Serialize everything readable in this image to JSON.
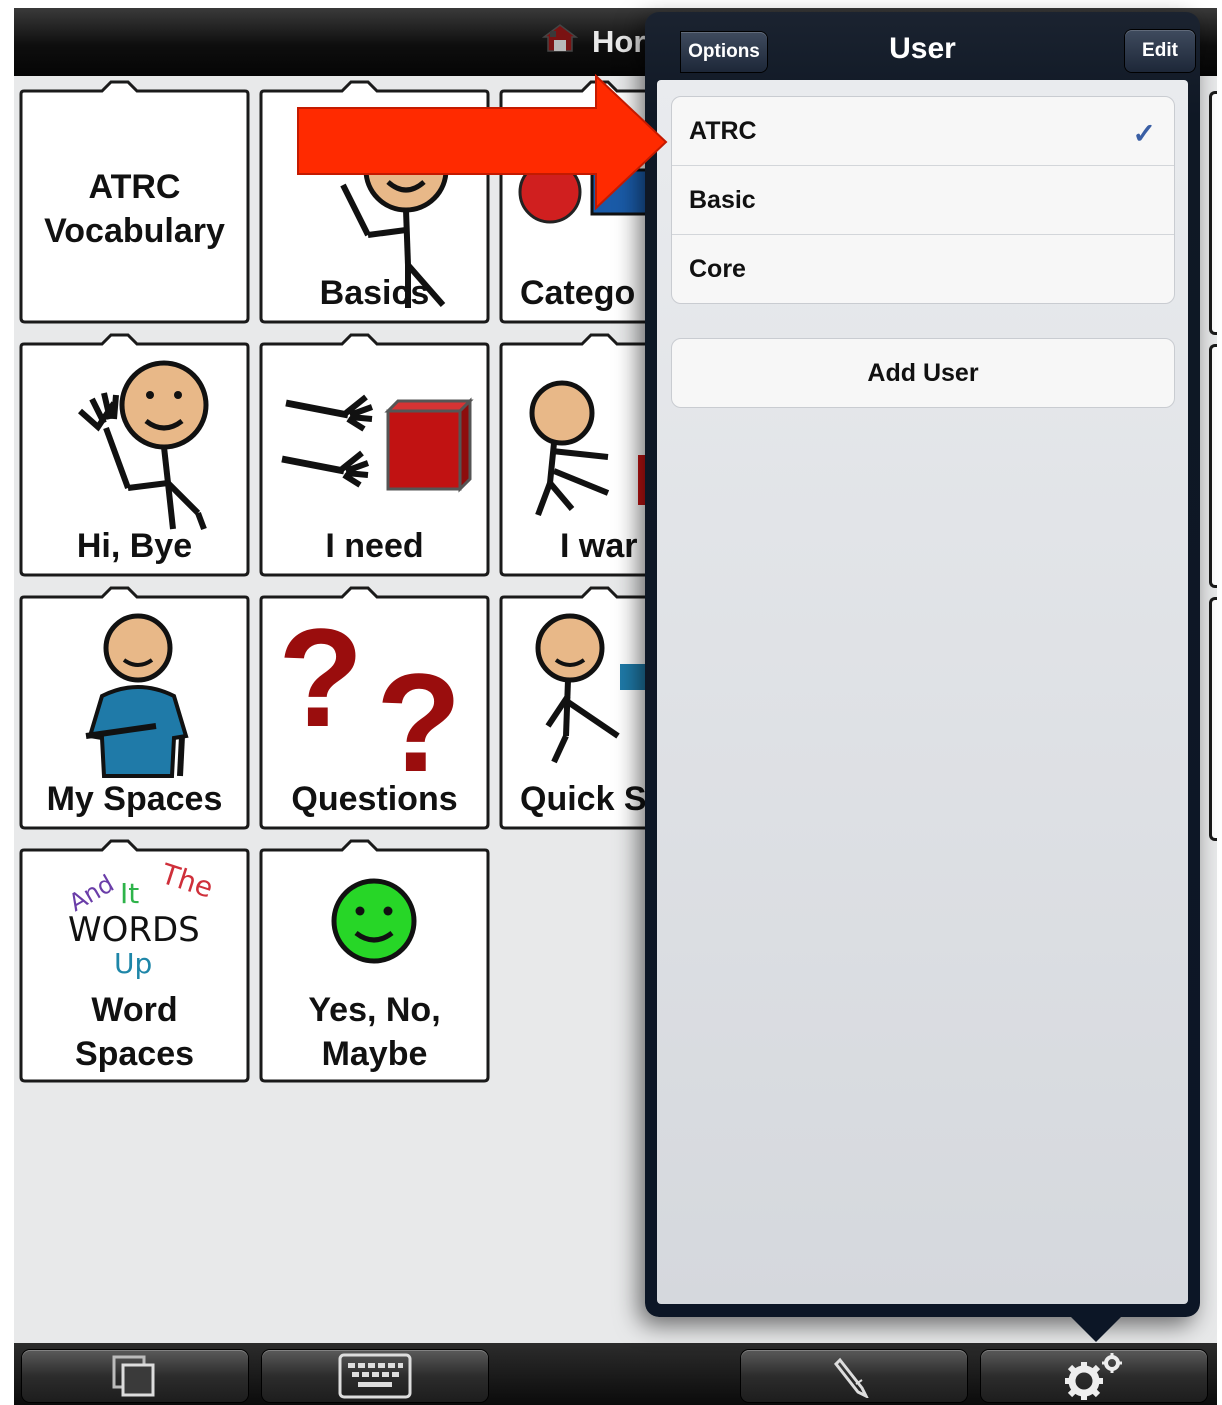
{
  "topbar": {
    "title": "Hor"
  },
  "folders": [
    {
      "label": "ATRC Vocabulary",
      "line1": "ATRC",
      "line2": "Vocabulary"
    },
    {
      "label": "Basics"
    },
    {
      "label": "Catego"
    },
    {
      "label": "Hi, Bye"
    },
    {
      "label": "I need"
    },
    {
      "label": "I war"
    },
    {
      "label": "My Spaces"
    },
    {
      "label": "Questions"
    },
    {
      "label": "Quick S"
    },
    {
      "label": "Word Spaces",
      "line1": "Word",
      "line2": "Spaces"
    },
    {
      "label": "Yes, No, Maybe",
      "line1": "Yes, No,",
      "line2": "Maybe"
    }
  ],
  "word_art": {
    "w1": "And",
    "w2": "It",
    "w3": "The",
    "w4": "WORDS",
    "w5": "Up"
  },
  "popover": {
    "title": "User",
    "options_label": "Options",
    "edit_label": "Edit",
    "users": [
      {
        "name": "ATRC",
        "selected": true
      },
      {
        "name": "Basic",
        "selected": false
      },
      {
        "name": "Core",
        "selected": false
      }
    ],
    "check_mark": "✓",
    "add_user_label": "Add User"
  },
  "toolbar": {
    "buttons": [
      "pages-icon",
      "keyboard-icon",
      "pencil-icon",
      "gear-icon"
    ]
  },
  "colors": {
    "arrow": "#ff2a00",
    "popover_dark": "#0c1626",
    "check": "#3a5fa5"
  }
}
